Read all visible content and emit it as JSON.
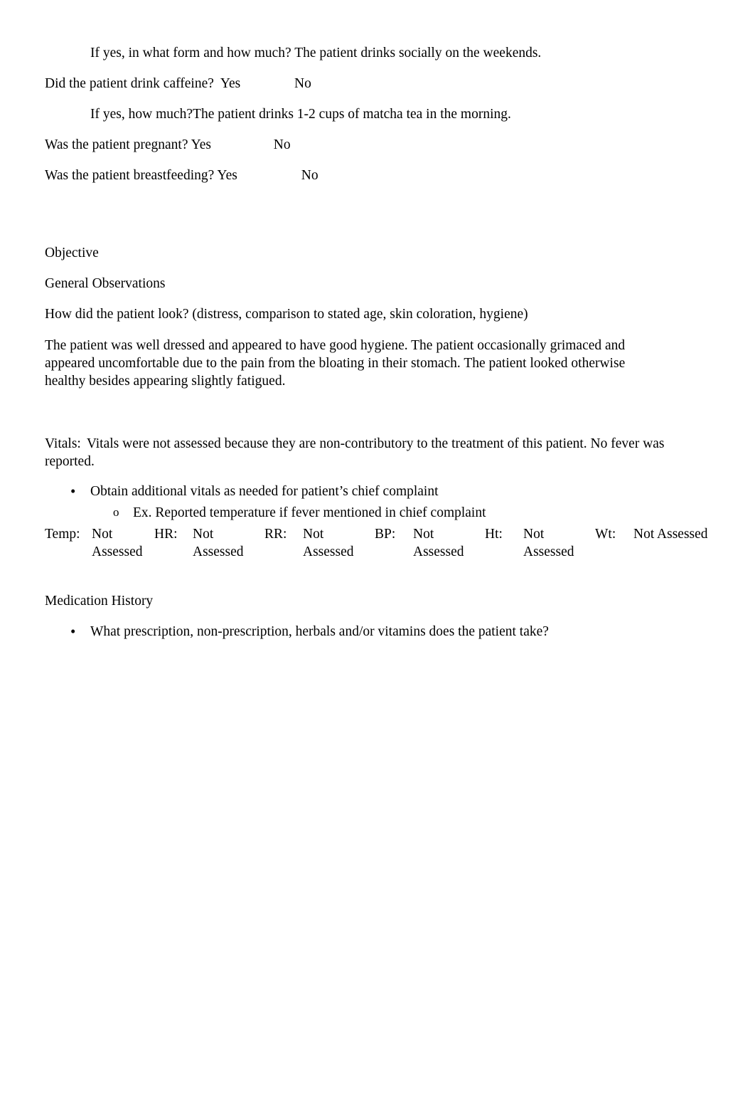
{
  "document": {
    "intro": {
      "alcohol_followup": "If yes, in what form and how much? The patient drinks socially on the weekends.",
      "caffeine_question": "Did the patient drink caffeine?  Yes\t        No",
      "caffeine_followup": "If yes, how much?The patient drinks 1-2 cups of matcha tea in the morning.",
      "pregnant_question": "Was the patient pregnant? Yes\t          No",
      "breastfeeding_question": "Was the patient breastfeeding? Yes\t          No"
    },
    "objective": {
      "heading": "Objective",
      "general_observations_heading": "General Observations",
      "look_question": "How did the patient look? (distress, comparison to stated age, skin coloration, hygiene)",
      "look_answer": "The patient was well dressed and appeared to have good hygiene. The patient occasionally grimaced and appeared uncomfortable due to the pain from the bloating in their stomach. The patient looked otherwise healthy besides appearing slightly fatigued."
    },
    "vitals": {
      "label": "Vitals:",
      "note": "Vitals were not assessed because they are non-contributory to the treatment of this patient. No fever was reported.",
      "bullets": [
        "Obtain additional vitals as needed for patient’s chief complaint"
      ],
      "sub_bullets": [
        "Ex. Reported temperature if fever mentioned in chief complaint"
      ],
      "table": {
        "temp_label": "Temp:",
        "temp_value": "Not Assessed",
        "hr_label": "HR:",
        "hr_value": "Not Assessed",
        "rr_label": "RR:",
        "rr_value": "Not Assessed",
        "bp_label": "BP:",
        "bp_value": "Not Assessed",
        "ht_label": "Ht:",
        "ht_value": "Not Assessed",
        "wt_label": "Wt:",
        "wt_value": "Not Assessed"
      }
    },
    "medication_history": {
      "heading": "Medication History",
      "bullets": [
        "What prescription, non-prescription, herbals and/or vitamins does the patient take?"
      ]
    }
  }
}
